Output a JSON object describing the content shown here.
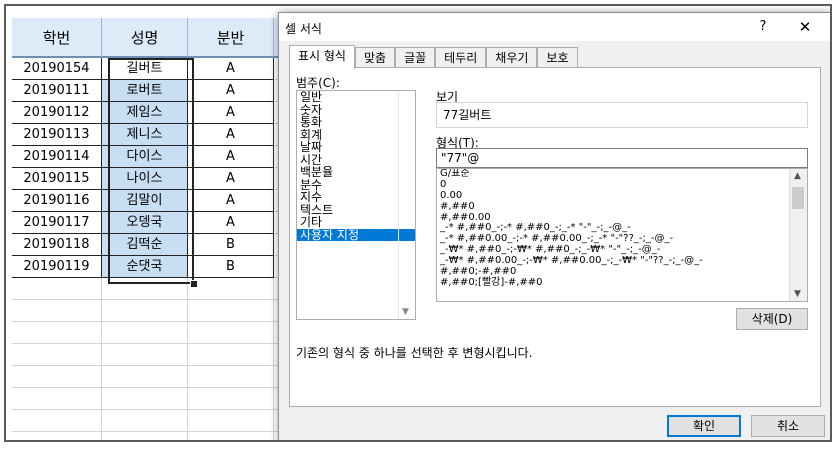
{
  "sheet": {
    "headers": [
      "학번",
      "성명",
      "분반"
    ],
    "rows": [
      {
        "id": "20190154",
        "name": "길버트",
        "class": "A"
      },
      {
        "id": "20190111",
        "name": "로버트",
        "class": "A"
      },
      {
        "id": "20190112",
        "name": "제임스",
        "class": "A"
      },
      {
        "id": "20190113",
        "name": "제니스",
        "class": "A"
      },
      {
        "id": "20190114",
        "name": "다이스",
        "class": "A"
      },
      {
        "id": "20190115",
        "name": "나이스",
        "class": "A"
      },
      {
        "id": "20190116",
        "name": "김말이",
        "class": "A"
      },
      {
        "id": "20190117",
        "name": "오뎅국",
        "class": "A"
      },
      {
        "id": "20190118",
        "name": "김떡순",
        "class": "B"
      },
      {
        "id": "20190119",
        "name": "순댓국",
        "class": "B"
      }
    ]
  },
  "dialog": {
    "title": "셀 서식",
    "help": "?",
    "close": "✕",
    "tabs": [
      "표시 형식",
      "맞춤",
      "글꼴",
      "테두리",
      "채우기",
      "보호"
    ],
    "category_label": "범주(C):",
    "categories": [
      "일반",
      "숫자",
      "통화",
      "회계",
      "날짜",
      "시간",
      "백분율",
      "분수",
      "지수",
      "텍스트",
      "기타",
      "사용자 지정"
    ],
    "active_category": "사용자 지정",
    "sample_label": "보기",
    "sample_value": "77길버트",
    "type_label": "형식(T):",
    "type_value": "\"77\"@",
    "formats": [
      "G/표준",
      "0",
      "0.00",
      "#,##0",
      "#,##0.00",
      "_-* #,##0_-;-* #,##0_-;_-* \"-\"_-;_-@_-",
      "_-* #,##0.00_-;-* #,##0.00_-;_-* \"-\"??_-;_-@_-",
      "_-₩* #,##0_-;-₩* #,##0_-;_-₩* \"-\"_-;_-@_-",
      "_-₩* #,##0.00_-;-₩* #,##0.00_-;_-₩* \"-\"??_-;_-@_-",
      "#,##0;-#,##0",
      "#,##0;[빨강]-#,##0"
    ],
    "delete_label": "삭제(D)",
    "description": "기존의 형식 중 하나를 선택한 후 변형시킵니다.",
    "ok_label": "확인",
    "cancel_label": "취소"
  }
}
